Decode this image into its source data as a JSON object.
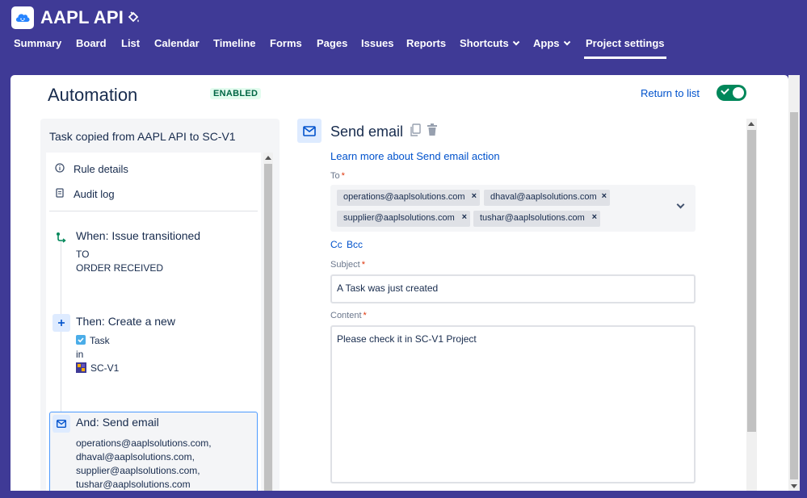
{
  "header": {
    "app_title": "AAPL API",
    "logo_icon": "cloud-icon",
    "theme_icon": "paint-bucket-icon"
  },
  "nav": {
    "items": [
      {
        "label": "Summary"
      },
      {
        "label": "Board"
      },
      {
        "label": "List"
      },
      {
        "label": "Calendar"
      },
      {
        "label": "Timeline"
      },
      {
        "label": "Forms"
      },
      {
        "label": "Pages"
      },
      {
        "label": "Issues"
      },
      {
        "label": "Reports"
      },
      {
        "label": "Shortcuts"
      },
      {
        "label": "Apps"
      },
      {
        "label": "Project settings"
      }
    ],
    "active": "Project settings"
  },
  "automation": {
    "title": "Automation",
    "status_badge": "ENABLED",
    "return_link": "Return to list",
    "toggle_on": true
  },
  "rule": {
    "name": "Task copied from AAPL API to SC-V1",
    "menu": [
      {
        "label": "Rule details",
        "icon": "info-icon"
      },
      {
        "label": "Audit log",
        "icon": "clipboard-icon"
      }
    ],
    "trigger": {
      "title": "When: Issue transitioned",
      "lines": [
        "TO",
        "ORDER RECEIVED"
      ]
    },
    "action": {
      "title": "Then: Create a new",
      "issue_type": "Task",
      "in_label": "in",
      "project": "SC-V1"
    },
    "email_action": {
      "title": "And: Send email",
      "lines": [
        "operations@aaplsolutions.com,",
        "dhaval@aaplsolutions.com,",
        "supplier@aaplsolutions.com,",
        "tushar@aaplsolutions.com"
      ]
    }
  },
  "editor": {
    "title": "Send email",
    "learn_link": "Learn more about Send email action",
    "to_label": "To",
    "recipients": [
      "operations@aaplsolutions.com",
      "dhaval@aaplsolutions.com",
      "supplier@aaplsolutions.com",
      "tushar@aaplsolutions.com"
    ],
    "chip_remove": "×",
    "cc": "Cc",
    "bcc": "Bcc",
    "subject_label": "Subject",
    "subject_value": "A Task was just created",
    "content_label": "Content",
    "content_value": "Please check it in SC-V1 Project",
    "required_mark": "*"
  },
  "colors": {
    "header_bg": "#3f3a96",
    "link": "#0052cc",
    "toggle_on": "#00875a",
    "enabled_text": "#006644",
    "enabled_bg": "#e3fcef",
    "required": "#de350b"
  }
}
